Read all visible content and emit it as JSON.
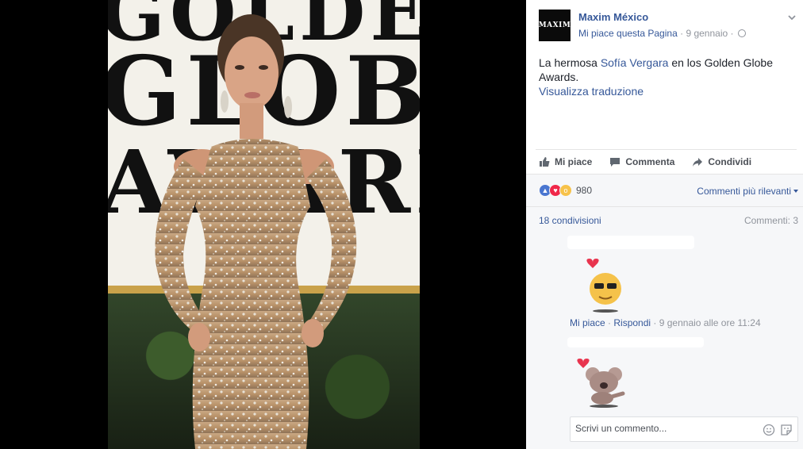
{
  "post": {
    "page_name": "Maxim México",
    "logo_text": "MAXIM",
    "like_page": "Mi piace questa Pagina",
    "separator": "·",
    "date": "9 gennaio",
    "text_before": "La hermosa ",
    "mention": "Sofía Vergara",
    "text_after": " en los Golden Globe Awards.",
    "translate": "Visualizza traduzione"
  },
  "photo": {
    "backdrop_row1": "GOLDEN",
    "backdrop_row2": "GLOBE",
    "backdrop_row3": "AWARDS"
  },
  "actions": {
    "like": "Mi piace",
    "comment": "Commenta",
    "share": "Condividi"
  },
  "stats": {
    "reactions_count": "980",
    "sort_label": "Commenti più rilevanti",
    "shares": "18 condivisioni",
    "comments": "Commenti: 3"
  },
  "comment1": {
    "like": "Mi piace",
    "dot": " · ",
    "reply": "Rispondi",
    "dot2": " · ",
    "time": "9 gennaio alle ore 11:24"
  },
  "composer": {
    "placeholder": "Scrivi un commento..."
  },
  "colors": {
    "link": "#365899",
    "muted": "#90949c",
    "panel": "#f6f7f9"
  }
}
